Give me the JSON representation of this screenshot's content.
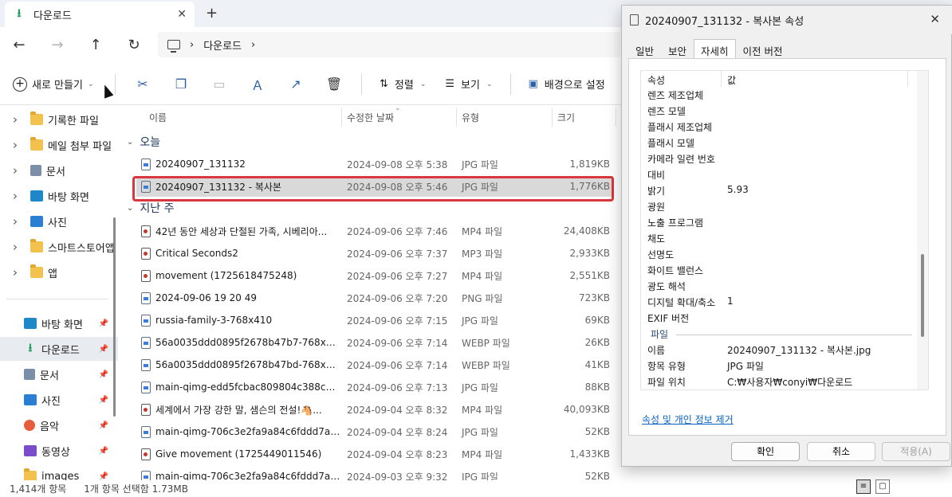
{
  "tab": {
    "title": "다운로드"
  },
  "address": {
    "crumb": "다운로드"
  },
  "toolbar": {
    "new_label": "새로 만들기",
    "sort_label": "정렬",
    "view_label": "보기",
    "background_label": "배경으로 설정"
  },
  "sidebar": {
    "tree": [
      {
        "label": "기록한 파일",
        "icon": "folder-icon"
      },
      {
        "label": "메일 첨부 파일",
        "icon": "folder-icon"
      },
      {
        "label": "문서",
        "icon": "document-icon"
      },
      {
        "label": "바탕 화면",
        "icon": "desktop-icon"
      },
      {
        "label": "사진",
        "icon": "picture-icon"
      },
      {
        "label": "스마트스토어앱",
        "icon": "folder-icon"
      },
      {
        "label": "앱",
        "icon": "folder-icon"
      }
    ],
    "pinned": [
      {
        "label": "바탕 화면",
        "icon": "desktop-icon"
      },
      {
        "label": "다운로드",
        "icon": "download-icon"
      },
      {
        "label": "문서",
        "icon": "document-icon"
      },
      {
        "label": "사진",
        "icon": "picture-icon"
      },
      {
        "label": "음악",
        "icon": "music-icon"
      },
      {
        "label": "동영상",
        "icon": "video-icon"
      },
      {
        "label": "images",
        "icon": "folder-icon"
      }
    ]
  },
  "columns": {
    "name": "이름",
    "modified": "수정한 날짜",
    "type": "유형",
    "size": "크기"
  },
  "groups": {
    "today": "오늘",
    "last_week": "지난 주"
  },
  "files_today": [
    {
      "name": "20240907_131132",
      "date": "2024-09-08 오후 5:38",
      "type": "JPG 파일",
      "size": "1,819KB",
      "kind": "img"
    },
    {
      "name": "20240907_131132 - 복사본",
      "date": "2024-09-08 오후 5:46",
      "type": "JPG 파일",
      "size": "1,776KB",
      "kind": "img"
    }
  ],
  "files_week": [
    {
      "name": "42년 동안 세상과 단절된 가족, 시베리아...",
      "date": "2024-09-06 오후 7:46",
      "type": "MP4 파일",
      "size": "24,408KB",
      "kind": "media"
    },
    {
      "name": "Critical Seconds2",
      "date": "2024-09-06 오후 7:37",
      "type": "MP3 파일",
      "size": "2,933KB",
      "kind": "media"
    },
    {
      "name": "movement (1725618475248)",
      "date": "2024-09-06 오후 7:27",
      "type": "MP4 파일",
      "size": "2,551KB",
      "kind": "media"
    },
    {
      "name": "2024-09-06 19 20 49",
      "date": "2024-09-06 오후 7:20",
      "type": "PNG 파일",
      "size": "723KB",
      "kind": "img"
    },
    {
      "name": "russia-family-3-768x410",
      "date": "2024-09-06 오후 7:15",
      "type": "JPG 파일",
      "size": "69KB",
      "kind": "img"
    },
    {
      "name": "56a0035ddd0895f2678b47b7-768x384",
      "date": "2024-09-06 오후 7:14",
      "type": "WEBP 파일",
      "size": "26KB",
      "kind": "img"
    },
    {
      "name": "56a0035ddd0895f2678b47bd-768x593",
      "date": "2024-09-06 오후 7:14",
      "type": "WEBP 파일",
      "size": "41KB",
      "kind": "img"
    },
    {
      "name": "main-qimg-edd5fcbac809804c388cb71...",
      "date": "2024-09-06 오후 7:13",
      "type": "JPG 파일",
      "size": "88KB",
      "kind": "img"
    },
    {
      "name": "세계에서 가장 강한 말, 샘슨의 전설!🐴...",
      "date": "2024-09-04 오후 8:32",
      "type": "MP4 파일",
      "size": "40,093KB",
      "kind": "media"
    },
    {
      "name": "main-qimg-706c3e2fa9a84c6fddd7a1f...",
      "date": "2024-09-04 오후 8:24",
      "type": "JPG 파일",
      "size": "52KB",
      "kind": "img"
    },
    {
      "name": "Give movement (1725449011546)",
      "date": "2024-09-04 오후 8:23",
      "type": "MP4 파일",
      "size": "1,433KB",
      "kind": "media"
    },
    {
      "name": "main-qimg-706c3e2fa9a84c6fddd7a1f...",
      "date": "2024-09-03 오후 9:32",
      "type": "JPG 파일",
      "size": "52KB",
      "kind": "img"
    }
  ],
  "status": {
    "count": "1,414개 항목",
    "selection": "1개 항목 선택함 1.73MB"
  },
  "dialog": {
    "title": "20240907_131132 - 복사본 속성",
    "tabs": [
      "일반",
      "보안",
      "자세히",
      "이전 버전"
    ],
    "col_property": "속성",
    "col_value": "값",
    "props": [
      {
        "k": "렌즈 제조업체",
        "v": ""
      },
      {
        "k": "렌즈 모델",
        "v": ""
      },
      {
        "k": "플래시 제조업체",
        "v": ""
      },
      {
        "k": "플래시 모델",
        "v": ""
      },
      {
        "k": "카메라 일련 번호",
        "v": ""
      },
      {
        "k": "대비",
        "v": ""
      },
      {
        "k": "밝기",
        "v": "5.93"
      },
      {
        "k": "광원",
        "v": ""
      },
      {
        "k": "노출 프로그램",
        "v": ""
      },
      {
        "k": "채도",
        "v": ""
      },
      {
        "k": "선명도",
        "v": ""
      },
      {
        "k": "화이트 밸런스",
        "v": ""
      },
      {
        "k": "광도 해석",
        "v": ""
      },
      {
        "k": "디지털 확대/축소",
        "v": "1"
      },
      {
        "k": "EXIF 버전",
        "v": ""
      }
    ],
    "section_file": "파일",
    "file_props": [
      {
        "k": "이름",
        "v": "20240907_131132 - 복사본.jpg"
      },
      {
        "k": "항목 유형",
        "v": "JPG 파일"
      },
      {
        "k": "파일 위치",
        "v": "C:₩사용자₩conyi₩다운로드"
      }
    ],
    "remove_link": "속성 및 개인 정보 제거",
    "ok": "확인",
    "cancel": "취소",
    "apply": "적용(A)"
  }
}
